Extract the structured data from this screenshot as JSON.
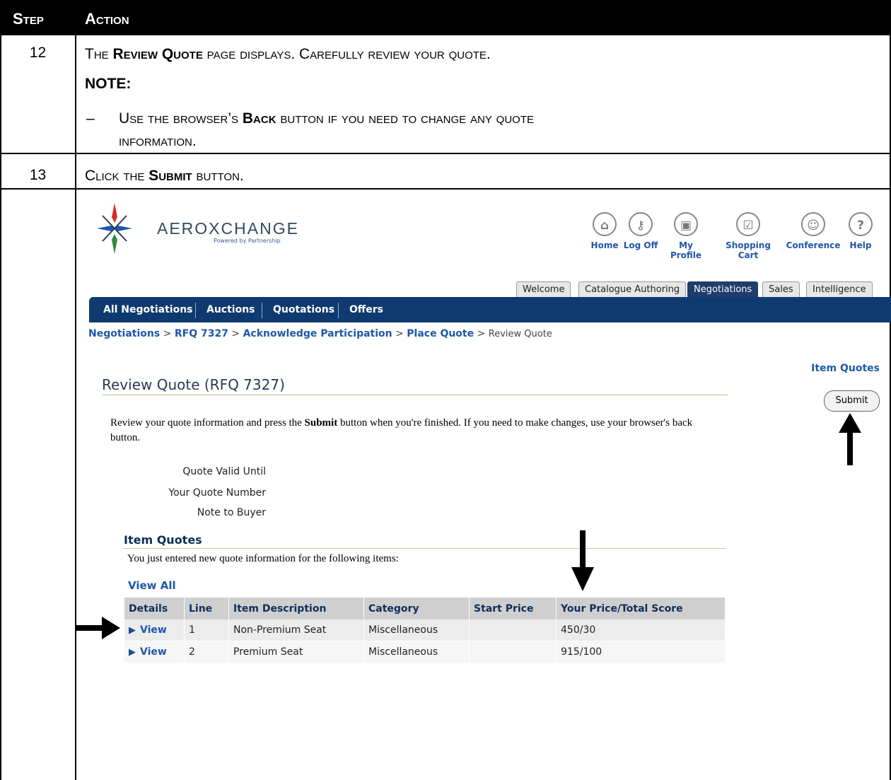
{
  "doc": {
    "header": {
      "step": "Step",
      "action": "Action"
    },
    "step12": {
      "num": "12",
      "line1_pre": "The ",
      "line1_bold": "Review Quote",
      "line1_post": " page displays. Carefully review your quote.",
      "note_label": "NOTE:",
      "bullet": "–",
      "line2_pre": "Use the browser’s ",
      "line2_bold": "Back",
      "line2_post": " button if you need to change any quote",
      "line3": "information."
    },
    "step13": {
      "num": "13",
      "pre": "Click the ",
      "bold": "Submit",
      "post": " button."
    }
  },
  "app": {
    "brand": "AEROXCHANGE",
    "brand_sub": "Powered by Partnership",
    "global_nav": [
      {
        "label": "Home",
        "icon": "home-icon",
        "glyph": "⌂"
      },
      {
        "label": "Log Off",
        "icon": "key-icon",
        "glyph": "⚷"
      },
      {
        "label": "My Profile",
        "icon": "briefcase-icon",
        "glyph": "▣"
      },
      {
        "label": "Shopping Cart",
        "icon": "cart-icon",
        "glyph": "☑"
      },
      {
        "label": "Conference",
        "icon": "conference-icon",
        "glyph": "☺"
      },
      {
        "label": "Help",
        "icon": "help-icon",
        "glyph": "?"
      }
    ],
    "tabs": [
      "Welcome",
      "Catalogue Authoring",
      "Negotiations",
      "Sales",
      "Intelligence"
    ],
    "active_tab": "Negotiations",
    "subnav": [
      "All Negotiations",
      "Auctions",
      "Quotations",
      "Offers"
    ],
    "breadcrumb": {
      "links": [
        "Negotiations",
        "RFQ 7327",
        "Acknowledge Participation",
        "Place Quote"
      ],
      "sep": ">",
      "current": "Review Quote"
    },
    "item_quotes_link": "Item Quotes",
    "submit_label": "Submit",
    "page_title": "Review Quote (RFQ 7327)",
    "intro_pre": "Review your quote information and press the ",
    "intro_bold": "Submit",
    "intro_post": " button when you're finished. If you need to make changes, use your browser's back button.",
    "fields": [
      "Quote Valid Until",
      "Your Quote Number",
      "Note to Buyer"
    ],
    "item_quotes": {
      "title": "Item Quotes",
      "text": "You just entered new quote information for the following items:",
      "view_all": "View All",
      "columns": [
        "Details",
        "Line",
        "Item Description",
        "Category",
        "Start Price",
        "Your Price/Total Score"
      ],
      "rows": [
        {
          "details": "View",
          "line": "1",
          "description": "Non-Premium Seat",
          "category": "Miscellaneous",
          "start_price": "",
          "price_score": "450/30"
        },
        {
          "details": "View",
          "line": "2",
          "description": "Premium Seat",
          "category": "Miscellaneous",
          "start_price": "",
          "price_score": "915/100"
        }
      ]
    }
  },
  "colors": {
    "link": "#1f57a8",
    "nav_bar": "#0e3a6f",
    "header_bg": "#000000"
  }
}
